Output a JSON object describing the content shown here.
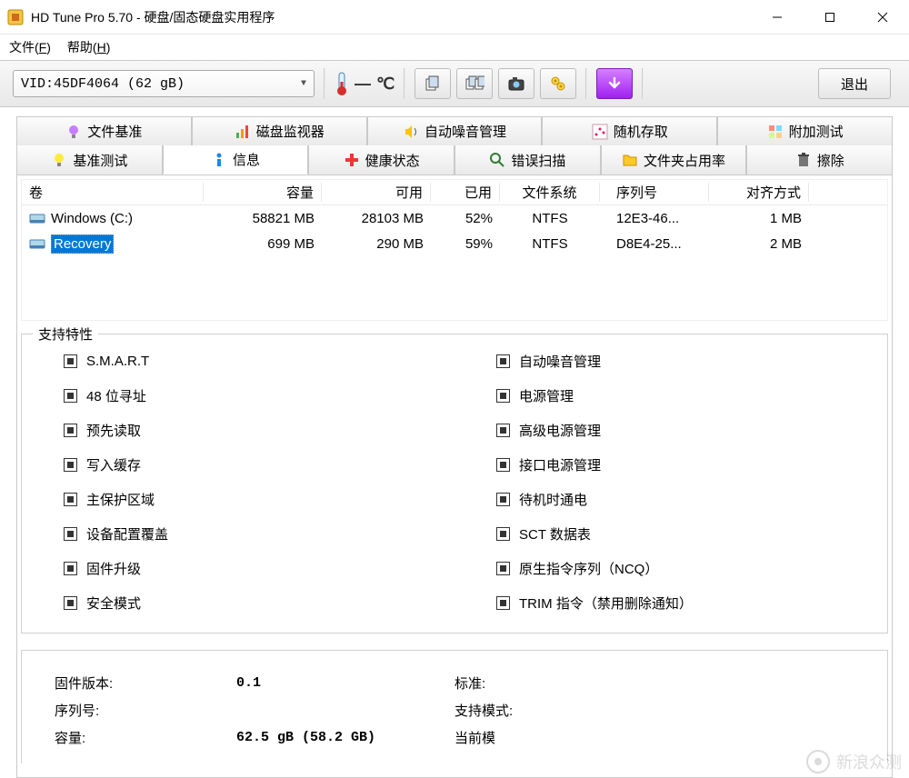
{
  "window": {
    "title": "HD Tune Pro 5.70 - 硬盘/固态硬盘实用程序"
  },
  "menu": {
    "file": "文件(F)",
    "help": "帮助(H)"
  },
  "toolbar": {
    "device": "VID:45DF4064 (62 gB)",
    "temp_value": "—",
    "temp_unit": "℃",
    "exit": "退出"
  },
  "tabs_row1": [
    {
      "label": "文件基准"
    },
    {
      "label": "磁盘监视器"
    },
    {
      "label": "自动噪音管理"
    },
    {
      "label": "随机存取"
    },
    {
      "label": "附加测试"
    }
  ],
  "tabs_row2": [
    {
      "label": "基准测试"
    },
    {
      "label": "信息",
      "active": true
    },
    {
      "label": "健康状态"
    },
    {
      "label": "错误扫描"
    },
    {
      "label": "文件夹占用率"
    },
    {
      "label": "擦除"
    }
  ],
  "grid": {
    "headers": {
      "vol": "卷",
      "cap": "容量",
      "avail": "可用",
      "used": "已用",
      "fs": "文件系统",
      "ser": "序列号",
      "al": "对齐方式"
    },
    "rows": [
      {
        "vol": "Windows (C:)",
        "cap": "58821 MB",
        "avail": "28103 MB",
        "used": "52%",
        "fs": "NTFS",
        "ser": "12E3-46...",
        "al": "1 MB",
        "selected": false
      },
      {
        "vol": "Recovery",
        "cap": "699 MB",
        "avail": "290 MB",
        "used": "59%",
        "fs": "NTFS",
        "ser": "D8E4-25...",
        "al": "2 MB",
        "selected": true
      }
    ]
  },
  "features": {
    "legend": "支持特性",
    "left": [
      "S.M.A.R.T",
      "48 位寻址",
      "预先读取",
      "写入缓存",
      "主保护区域",
      "设备配置覆盖",
      "固件升级",
      "安全模式"
    ],
    "right": [
      "自动噪音管理",
      "电源管理",
      "高级电源管理",
      "接口电源管理",
      "待机时通电",
      "SCT 数据表",
      "原生指令序列（NCQ）",
      "TRIM 指令（禁用删除通知）"
    ]
  },
  "info": {
    "left": [
      {
        "lbl": "固件版本:",
        "val": "0.1"
      },
      {
        "lbl": "序列号:",
        "val": ""
      },
      {
        "lbl": "容量:",
        "val": "62.5 gB (58.2 GB)"
      }
    ],
    "right": [
      {
        "lbl": "标准:",
        "val": ""
      },
      {
        "lbl": "支持模式:",
        "val": ""
      },
      {
        "lbl": "当前模",
        "val": ""
      }
    ]
  },
  "watermark": "新浪众测"
}
